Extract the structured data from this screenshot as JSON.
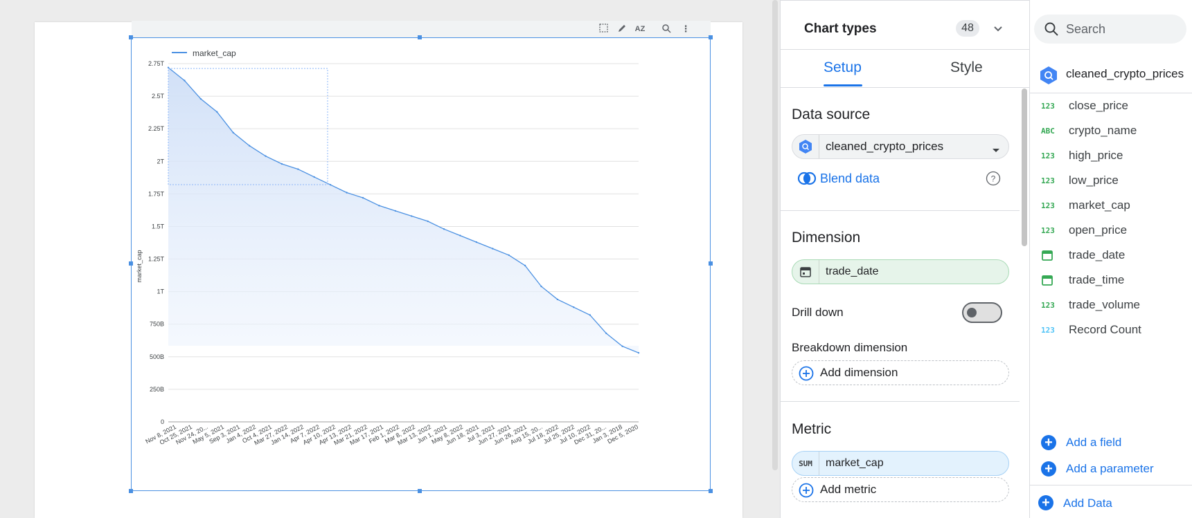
{
  "canvas": {
    "toolbar_icons": [
      "select-icon",
      "pencil-icon",
      "sort-az-icon",
      "zoom-icon",
      "more-vert-icon"
    ]
  },
  "chart_data": {
    "type": "area",
    "legend": [
      "market_cap"
    ],
    "legend_position": "top-left",
    "ylabel": "market_cap",
    "xlabel": "",
    "y_ticks": [
      "0",
      "250B",
      "500B",
      "750B",
      "1T",
      "1.25T",
      "1.5T",
      "1.75T",
      "2T",
      "2.25T",
      "2.5T",
      "2.75T"
    ],
    "ylim": [
      0,
      2750000000000
    ],
    "x_tick_labels": [
      "Nov 8, 2021",
      "Oct 25, 2021",
      "Nov 24, 20...",
      "May 5, 2021",
      "Sep 3, 2021",
      "Jan 4, 2022",
      "Oct 4, 2021",
      "Mar 27, 2022",
      "Jan 14, 2022",
      "Apr 7, 2022",
      "Apr 10, 2022",
      "Apr 13, 2022",
      "Mar 21, 2022",
      "Mar 17, 2021",
      "Feb 1, 2022",
      "Mar 8, 2022",
      "Mar 13, 2022",
      "Jun 1, 2021",
      "May 8, 2022",
      "Jun 18, 2021",
      "Jul 3, 2021",
      "Jun 27, 2021",
      "Jun 26, 2021",
      "Aug 15, 20...",
      "Jul 18, 2022",
      "Jul 25, 2022",
      "Jul 10, 2022",
      "Dec 31, 20...",
      "Jan 3, 2018",
      "Dec 5, 2020"
    ],
    "series": [
      {
        "name": "market_cap",
        "color": "#4a90e2",
        "values": [
          2.72,
          2.62,
          2.48,
          2.38,
          2.22,
          2.12,
          2.04,
          1.98,
          1.94,
          1.88,
          1.82,
          1.76,
          1.72,
          1.66,
          1.62,
          1.58,
          1.54,
          1.48,
          1.43,
          1.38,
          1.33,
          1.28,
          1.2,
          1.04,
          0.94,
          0.88,
          0.82,
          0.68,
          0.58,
          0.53
        ]
      }
    ],
    "grid": true
  },
  "props": {
    "chart_types_label": "Chart types",
    "chart_types_count": "48",
    "tabs": {
      "setup": "Setup",
      "style": "Style"
    },
    "data_source": {
      "title": "Data source",
      "value": "cleaned_crypto_prices",
      "blend_label": "Blend data"
    },
    "dimension": {
      "title": "Dimension",
      "field": "trade_date",
      "drill_down_label": "Drill down",
      "drill_down_on": false,
      "breakdown_title": "Breakdown dimension",
      "add_label": "Add dimension"
    },
    "metric": {
      "title": "Metric",
      "agg": "SUM",
      "field": "market_cap",
      "add_label": "Add metric"
    }
  },
  "fields": {
    "search_placeholder": "Search",
    "data_source_name": "cleaned_crypto_prices",
    "items": [
      {
        "type": "123",
        "name": "close_price",
        "color": "#34a853"
      },
      {
        "type": "ABC",
        "name": "crypto_name",
        "color": "#34a853"
      },
      {
        "type": "123",
        "name": "high_price",
        "color": "#34a853"
      },
      {
        "type": "123",
        "name": "low_price",
        "color": "#34a853"
      },
      {
        "type": "123",
        "name": "market_cap",
        "color": "#34a853"
      },
      {
        "type": "123",
        "name": "open_price",
        "color": "#34a853"
      },
      {
        "type": "date",
        "name": "trade_date",
        "color": "#34a853"
      },
      {
        "type": "date",
        "name": "trade_time",
        "color": "#34a853"
      },
      {
        "type": "123",
        "name": "trade_volume",
        "color": "#34a853"
      },
      {
        "type": "123",
        "name": "Record Count",
        "color": "#4fc3f7"
      }
    ],
    "add_field_label": "Add a field",
    "add_parameter_label": "Add a parameter",
    "add_data_label": "Add Data"
  }
}
